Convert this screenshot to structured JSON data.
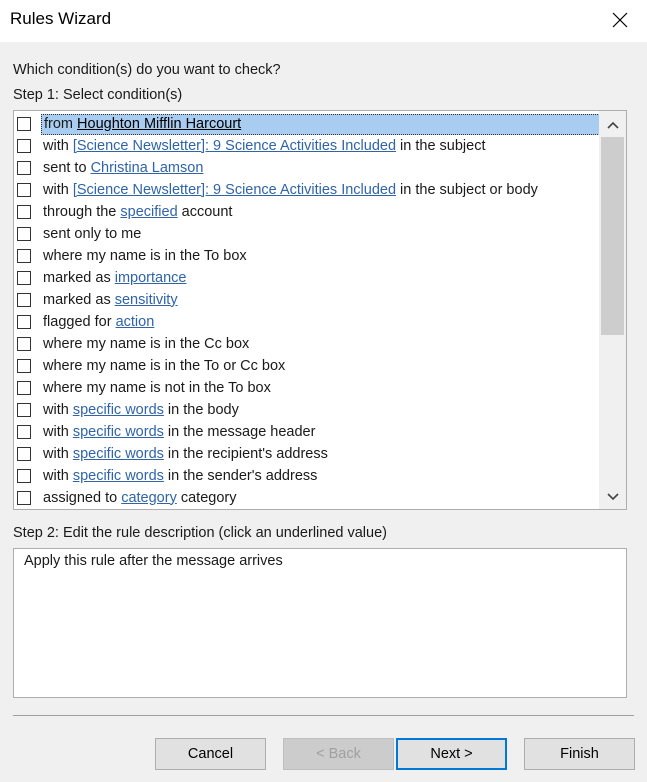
{
  "window": {
    "title": "Rules Wizard"
  },
  "prompt": "Which condition(s) do you want to check?",
  "step1_label": "Step 1: Select condition(s)",
  "conditions": [
    {
      "pre": "from ",
      "link": "Houghton Mifflin Harcourt",
      "post": "",
      "checked": false,
      "selected": true
    },
    {
      "pre": "with ",
      "link": "[Science Newsletter]: 9 Science Activities Included",
      "post": " in the subject",
      "checked": false,
      "selected": false
    },
    {
      "pre": "sent to ",
      "link": "Christina Lamson",
      "post": "",
      "checked": false,
      "selected": false
    },
    {
      "pre": "with ",
      "link": "[Science Newsletter]: 9 Science Activities Included",
      "post": " in the subject or body",
      "checked": false,
      "selected": false
    },
    {
      "pre": "through the ",
      "link": "specified",
      "post": " account",
      "checked": false,
      "selected": false
    },
    {
      "pre": "sent only to me",
      "link": "",
      "post": "",
      "checked": false,
      "selected": false
    },
    {
      "pre": "where my name is in the To box",
      "link": "",
      "post": "",
      "checked": false,
      "selected": false
    },
    {
      "pre": "marked as ",
      "link": "importance",
      "post": "",
      "checked": false,
      "selected": false
    },
    {
      "pre": "marked as ",
      "link": "sensitivity",
      "post": "",
      "checked": false,
      "selected": false
    },
    {
      "pre": "flagged for ",
      "link": "action",
      "post": "",
      "checked": false,
      "selected": false
    },
    {
      "pre": "where my name is in the Cc box",
      "link": "",
      "post": "",
      "checked": false,
      "selected": false
    },
    {
      "pre": "where my name is in the To or Cc box",
      "link": "",
      "post": "",
      "checked": false,
      "selected": false
    },
    {
      "pre": "where my name is not in the To box",
      "link": "",
      "post": "",
      "checked": false,
      "selected": false
    },
    {
      "pre": "with ",
      "link": "specific words",
      "post": " in the body",
      "checked": false,
      "selected": false
    },
    {
      "pre": "with ",
      "link": "specific words",
      "post": " in the message header",
      "checked": false,
      "selected": false
    },
    {
      "pre": "with ",
      "link": "specific words",
      "post": " in the recipient's address",
      "checked": false,
      "selected": false
    },
    {
      "pre": "with ",
      "link": "specific words",
      "post": " in the sender's address",
      "checked": false,
      "selected": false
    },
    {
      "pre": "assigned to ",
      "link": "category",
      "post": " category",
      "checked": false,
      "selected": false
    }
  ],
  "step2_label": "Step 2: Edit the rule description (click an underlined value)",
  "rule_description": "Apply this rule after the message arrives",
  "buttons": {
    "cancel": "Cancel",
    "back": "< Back",
    "next": "Next >",
    "finish": "Finish"
  },
  "icons": {
    "close": "close-icon",
    "scroll_up": "chevron-up-icon",
    "scroll_down": "chevron-down-icon"
  }
}
